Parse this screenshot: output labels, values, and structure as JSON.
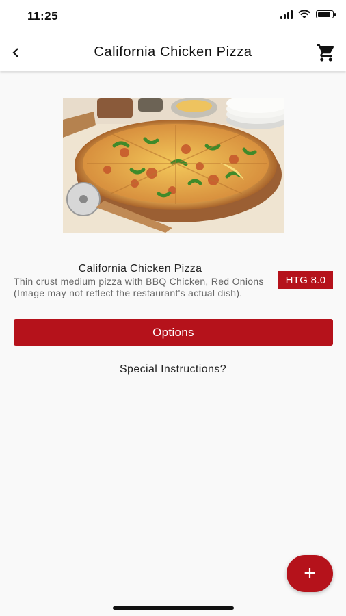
{
  "status_bar": {
    "time": "11:25",
    "battery_level": 0.9
  },
  "app_bar": {
    "title": "California Chicken Pizza",
    "back_icon": "chevron-left-icon",
    "cart_icon": "cart-icon"
  },
  "product": {
    "name": "California Chicken Pizza",
    "description": "Thin crust medium pizza with BBQ Chicken, Red Onions (Image may not reflect the restaurant's actual dish).",
    "price": "HTG 8.0"
  },
  "actions": {
    "options_label": "Options",
    "special_instructions": "Special Instructions?",
    "fab_label": "+"
  },
  "colors": {
    "accent": "#b5121b",
    "background": "#f9f9f9"
  }
}
